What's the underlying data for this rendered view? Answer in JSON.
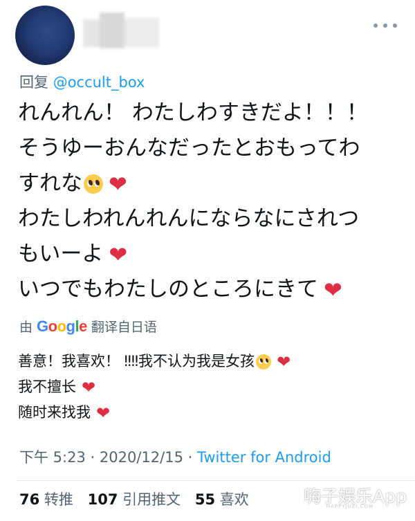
{
  "tweet": {
    "reply_prefix": "回复",
    "reply_handle": "@occult_box",
    "lines": [
      "れんれん！ わたしわすきだよ！！！",
      "そうゆーおんなだったとおもってわ",
      "すれな",
      "わたしわれんれんにならなにされつ",
      "もいーよ",
      "いつでもわたしのところにきて"
    ]
  },
  "translation": {
    "by_label": "由",
    "google_logo": "Google",
    "suffix_label": "翻译自日语",
    "lines": [
      "善意！我喜欢！ ‼‼我不认为我是女孩",
      "我不擅长",
      "随时来找我"
    ]
  },
  "meta": {
    "time": "下午 5:23",
    "separator": "·",
    "date": "2020/12/15",
    "source": "Twitter for Android"
  },
  "stats": {
    "retweets_count": "76",
    "retweets_label": "转推",
    "quotes_count": "107",
    "quotes_label": "引用推文",
    "likes_count": "55",
    "likes_label": "喜欢"
  },
  "watermark": {
    "text": "嗨子娱乐App",
    "sub": "HAPPYJUZI.COM"
  },
  "icons": {
    "heart": "❤",
    "more": "more-horizontal-icon"
  },
  "colors": {
    "link": "#1d9bf0",
    "secondary_text": "#536471",
    "heart": "#dd2e44"
  }
}
